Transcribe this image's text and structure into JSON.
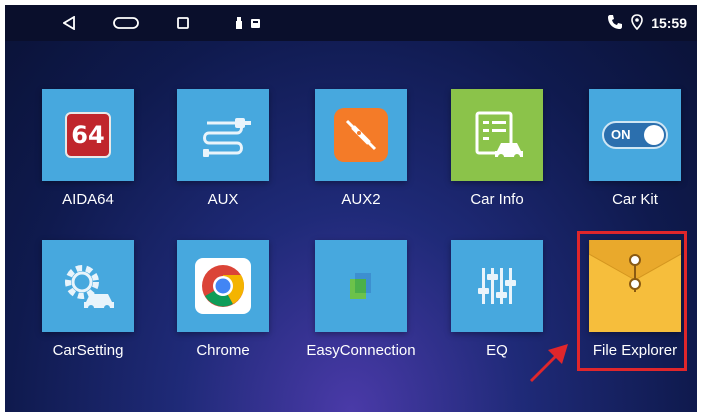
{
  "statusbar": {
    "time": "15:59",
    "nav_icons": [
      "back-icon",
      "home-icon",
      "recents-icon"
    ],
    "status_icons": [
      "usb-icon",
      "sd-card-icon",
      "phone-icon",
      "location-icon"
    ]
  },
  "apps": [
    {
      "label": "AIDA64",
      "icon": "aida64-icon",
      "tile_text": "64"
    },
    {
      "label": "AUX",
      "icon": "aux-cable-icon"
    },
    {
      "label": "AUX2",
      "icon": "aux2-jack-icon"
    },
    {
      "label": "Car Info",
      "icon": "car-info-icon"
    },
    {
      "label": "Car Kit",
      "icon": "car-kit-toggle-icon",
      "tile_text": "ON"
    },
    {
      "label": "CarSetting",
      "icon": "car-setting-gear-icon"
    },
    {
      "label": "Chrome",
      "icon": "chrome-icon"
    },
    {
      "label": "EasyConnection",
      "icon": "easyconnection-icon"
    },
    {
      "label": "EQ",
      "icon": "eq-sliders-icon"
    },
    {
      "label": "File Explorer",
      "icon": "file-explorer-folder-icon"
    }
  ],
  "colors": {
    "tile_blue": "#47a8de",
    "highlight_red": "#e0262b",
    "aux2_orange": "#f47b28",
    "carinfo_green": "#8bc34a",
    "folder_yellow": "#f6be3c"
  }
}
